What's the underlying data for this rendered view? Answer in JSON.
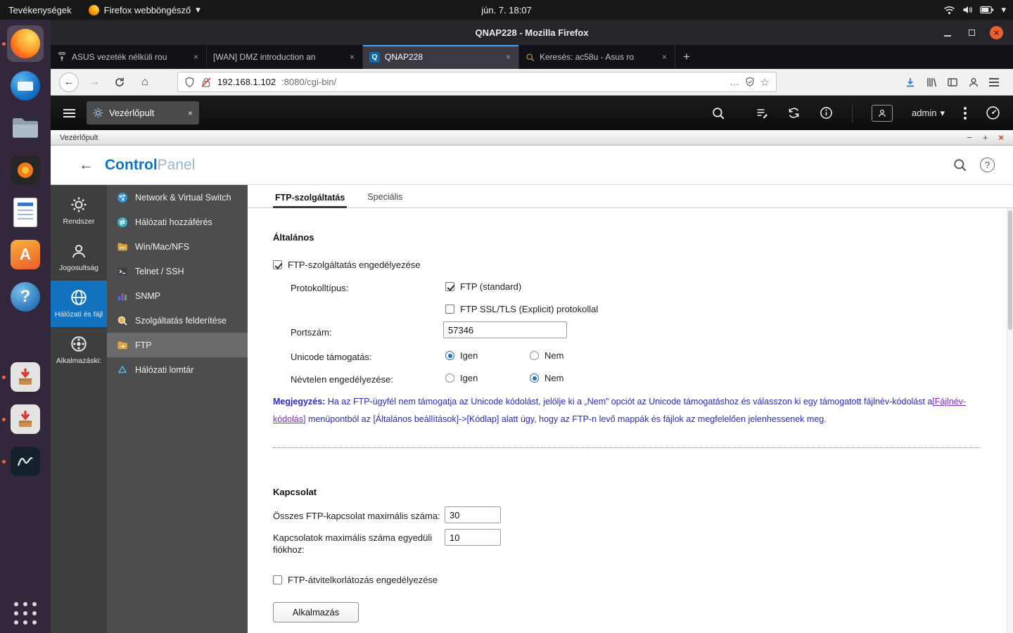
{
  "icons": {
    "caret_down": "▾",
    "minimize": "−",
    "close": "×",
    "plus": "+",
    "back": "←",
    "forward": "→",
    "home": "⌂",
    "ellipsis": "…",
    "star": "☆",
    "question": "?",
    "qnap_logo": "Q",
    "software_letter": "A"
  },
  "topbar": {
    "activities": "Tevékenységek",
    "app_name": "Firefox webböngésző",
    "clock": "jún. 7.  18:07"
  },
  "firefox": {
    "window_title": "QNAP228 - Mozilla Firefox",
    "tabs": [
      {
        "label": "ASUS vezeték nélküli rou"
      },
      {
        "label": "[WAN] DMZ introduction an"
      },
      {
        "label": "QNAP228"
      },
      {
        "label": "Keresés: ac58u - Asus ro"
      }
    ],
    "url_host": "192.168.1.102",
    "url_path": ":8080/cgi-bin/"
  },
  "qnap": {
    "desktop_tab": "Vezérlőpult",
    "user": "admin",
    "window_title": "Vezérlőpult",
    "cp_title_strong": "Control",
    "cp_title_light": "Panel",
    "groups": [
      {
        "label": "Rendszer"
      },
      {
        "label": "Jogosultság"
      },
      {
        "label": "Hálózati és fájl"
      },
      {
        "label": "Alkalmazáski:"
      }
    ],
    "menu": [
      {
        "label": "Network & Virtual Switch"
      },
      {
        "label": "Hálózati hozzáférés"
      },
      {
        "label": "Win/Mac/NFS"
      },
      {
        "label": "Telnet / SSH"
      },
      {
        "label": "SNMP"
      },
      {
        "label": "Szolgáltatás felderítése"
      },
      {
        "label": "FTP"
      },
      {
        "label": "Hálózati lomtár"
      }
    ],
    "page": {
      "tab_ftp": "FTP-szolgáltatás",
      "tab_advanced": "Speciális",
      "section_general": "Általános",
      "enable_ftp": "FTP-szolgáltatás engedélyezése",
      "protocol_type": "Protokolltípus:",
      "protocol_standard": "FTP (standard)",
      "protocol_ssl": "FTP SSL/TLS (Explicit) protokollal",
      "port_number": "Portszám:",
      "port_value": "57346",
      "unicode_support": "Unicode támogatás:",
      "yes": "Igen",
      "no": "Nem",
      "unicode_value": "Igen",
      "anonymous": "Névtelen engedélyezése:",
      "anonymous_value": "Nem",
      "note_label": "Megjegyzés:",
      "note_text_1": " Ha az FTP-ügyfél nem támogatja az Unicode kódolást, jelölje ki a „Nem” opciót az Unicode támogatáshoz és válasszon ki egy támogatott fájlnév-kódolást a",
      "note_link": "[Fájlnév-kódolás]",
      "note_text_2": " menüpontból az [Általános beállítások]->[Kódlap] alatt úgy, hogy az FTP-n levő mappák és fájlok az megfelelően jelenhessenek meg.",
      "section_connection": "Kapcsolat",
      "max_connections": "Összes FTP-kapcsolat maximális száma:",
      "max_connections_value": "30",
      "max_per_account": "Kapcsolatok maximális száma egyedüli fiókhoz:",
      "max_per_account_value": "10",
      "enable_limit": "FTP-átvitelkorlátozás engedélyezése",
      "apply": "Alkalmazás"
    }
  }
}
